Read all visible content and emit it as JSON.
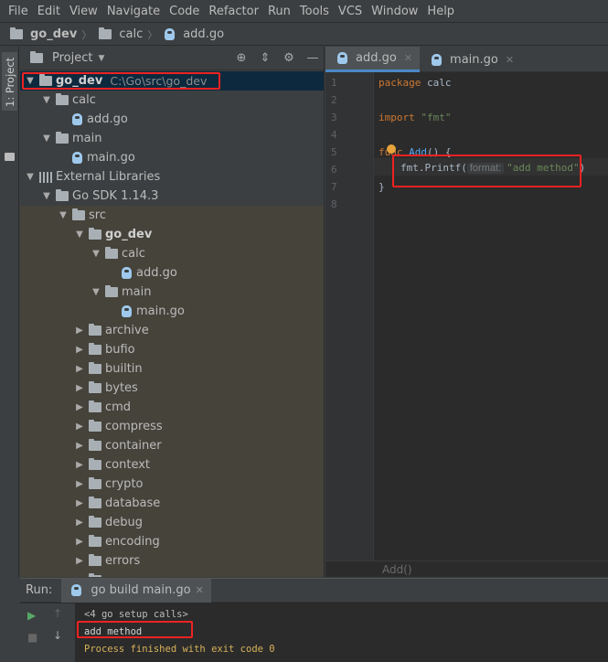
{
  "menu": [
    "File",
    "Edit",
    "View",
    "Navigate",
    "Code",
    "Refactor",
    "Run",
    "Tools",
    "VCS",
    "Window",
    "Help"
  ],
  "breadcrumb": {
    "project": "go_dev",
    "folder": "calc",
    "file": "add.go"
  },
  "left_strip": {
    "project_tab": "1: Project"
  },
  "project_panel": {
    "title": "Project",
    "tree": [
      {
        "label": "go_dev",
        "path": "C:\\Go\\src\\go_dev",
        "bold": true,
        "indent": 0,
        "type": "folder",
        "open": true
      },
      {
        "label": "calc",
        "indent": 1,
        "type": "folder",
        "open": true
      },
      {
        "label": "add.go",
        "indent": 2,
        "type": "file"
      },
      {
        "label": "main",
        "indent": 1,
        "type": "folder",
        "open": true
      },
      {
        "label": "main.go",
        "indent": 2,
        "type": "file"
      },
      {
        "label": "External Libraries",
        "indent": 0,
        "type": "lib",
        "open": true
      },
      {
        "label": "Go SDK 1.14.3",
        "indent": 1,
        "type": "folder",
        "open": true
      },
      {
        "label": "src",
        "indent": 2,
        "type": "folder",
        "open": true
      },
      {
        "label": "go_dev",
        "bold": true,
        "indent": 3,
        "type": "folder",
        "open": true
      },
      {
        "label": "calc",
        "indent": 4,
        "type": "folder",
        "open": true
      },
      {
        "label": "add.go",
        "indent": 5,
        "type": "file"
      },
      {
        "label": "main",
        "indent": 4,
        "type": "folder",
        "open": true
      },
      {
        "label": "main.go",
        "indent": 5,
        "type": "file"
      },
      {
        "label": "archive",
        "indent": 3,
        "type": "folder",
        "open": false
      },
      {
        "label": "bufio",
        "indent": 3,
        "type": "folder",
        "open": false
      },
      {
        "label": "builtin",
        "indent": 3,
        "type": "folder",
        "open": false
      },
      {
        "label": "bytes",
        "indent": 3,
        "type": "folder",
        "open": false
      },
      {
        "label": "cmd",
        "indent": 3,
        "type": "folder",
        "open": false
      },
      {
        "label": "compress",
        "indent": 3,
        "type": "folder",
        "open": false
      },
      {
        "label": "container",
        "indent": 3,
        "type": "folder",
        "open": false
      },
      {
        "label": "context",
        "indent": 3,
        "type": "folder",
        "open": false
      },
      {
        "label": "crypto",
        "indent": 3,
        "type": "folder",
        "open": false
      },
      {
        "label": "database",
        "indent": 3,
        "type": "folder",
        "open": false
      },
      {
        "label": "debug",
        "indent": 3,
        "type": "folder",
        "open": false
      },
      {
        "label": "encoding",
        "indent": 3,
        "type": "folder",
        "open": false
      },
      {
        "label": "errors",
        "indent": 3,
        "type": "folder",
        "open": false
      },
      {
        "label": "",
        "indent": 3,
        "type": "folder",
        "open": false
      }
    ]
  },
  "editor": {
    "tabs": [
      {
        "label": "add.go",
        "active": true
      },
      {
        "label": "main.go",
        "active": false
      }
    ],
    "line_numbers": [
      "1",
      "2",
      "3",
      "4",
      "5",
      "6",
      "7",
      "8"
    ],
    "code": {
      "l1_kw": "package",
      "l1_rest": " calc",
      "l3_kw": "import",
      "l3_str": " \"fmt\"",
      "l5_kw": "func",
      "l5_fn": "Add",
      "l5_rest": "() {",
      "l6_call": "fmt.Printf(",
      "l6_hint": "format:",
      "l6_str": "\"add method\"",
      "l6_end": ")",
      "l7": "}"
    },
    "footer": "Add()"
  },
  "run_panel": {
    "label": "Run:",
    "tab": "go build main.go",
    "output": [
      {
        "text": "<4 go setup calls>",
        "color": "#bbbbbb"
      },
      {
        "text": "add method",
        "color": "#d6d6d6"
      },
      {
        "text": "Process finished with exit code 0",
        "color": "#d7b25a"
      }
    ]
  }
}
